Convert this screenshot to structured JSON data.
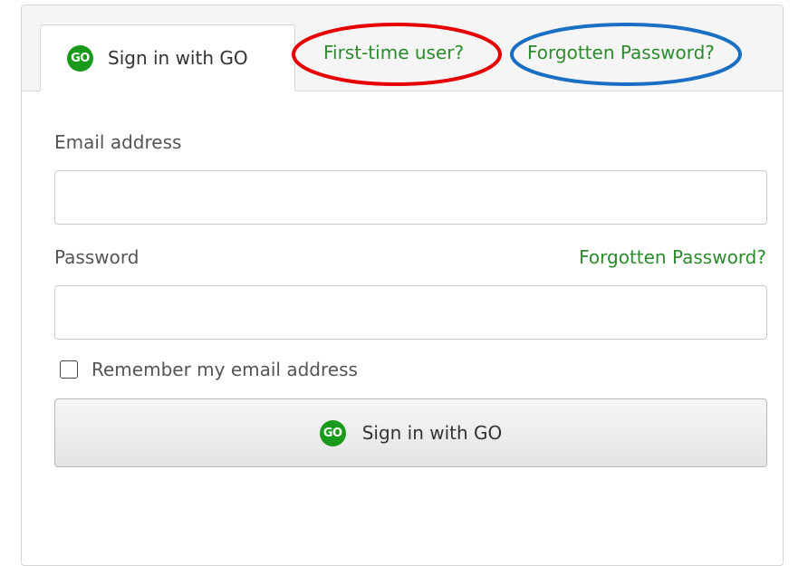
{
  "tabs": {
    "sign_in": {
      "badge": "GO",
      "label": "Sign in with GO"
    },
    "first_time": {
      "label": "First-time user?"
    },
    "forgotten": {
      "label": "Forgotten Password?"
    }
  },
  "form": {
    "email_label": "Email address",
    "email_value": "",
    "password_label": "Password",
    "password_value": "",
    "forgotten_link": "Forgotten Password?",
    "remember_label": "Remember my email address",
    "remember_checked": false,
    "submit_badge": "GO",
    "submit_label": "Sign in with GO"
  },
  "colors": {
    "brand_green": "#1a9a1a",
    "link_green": "#2d8a2d",
    "highlight_red": "#e60000",
    "highlight_blue": "#1a6fc4"
  }
}
